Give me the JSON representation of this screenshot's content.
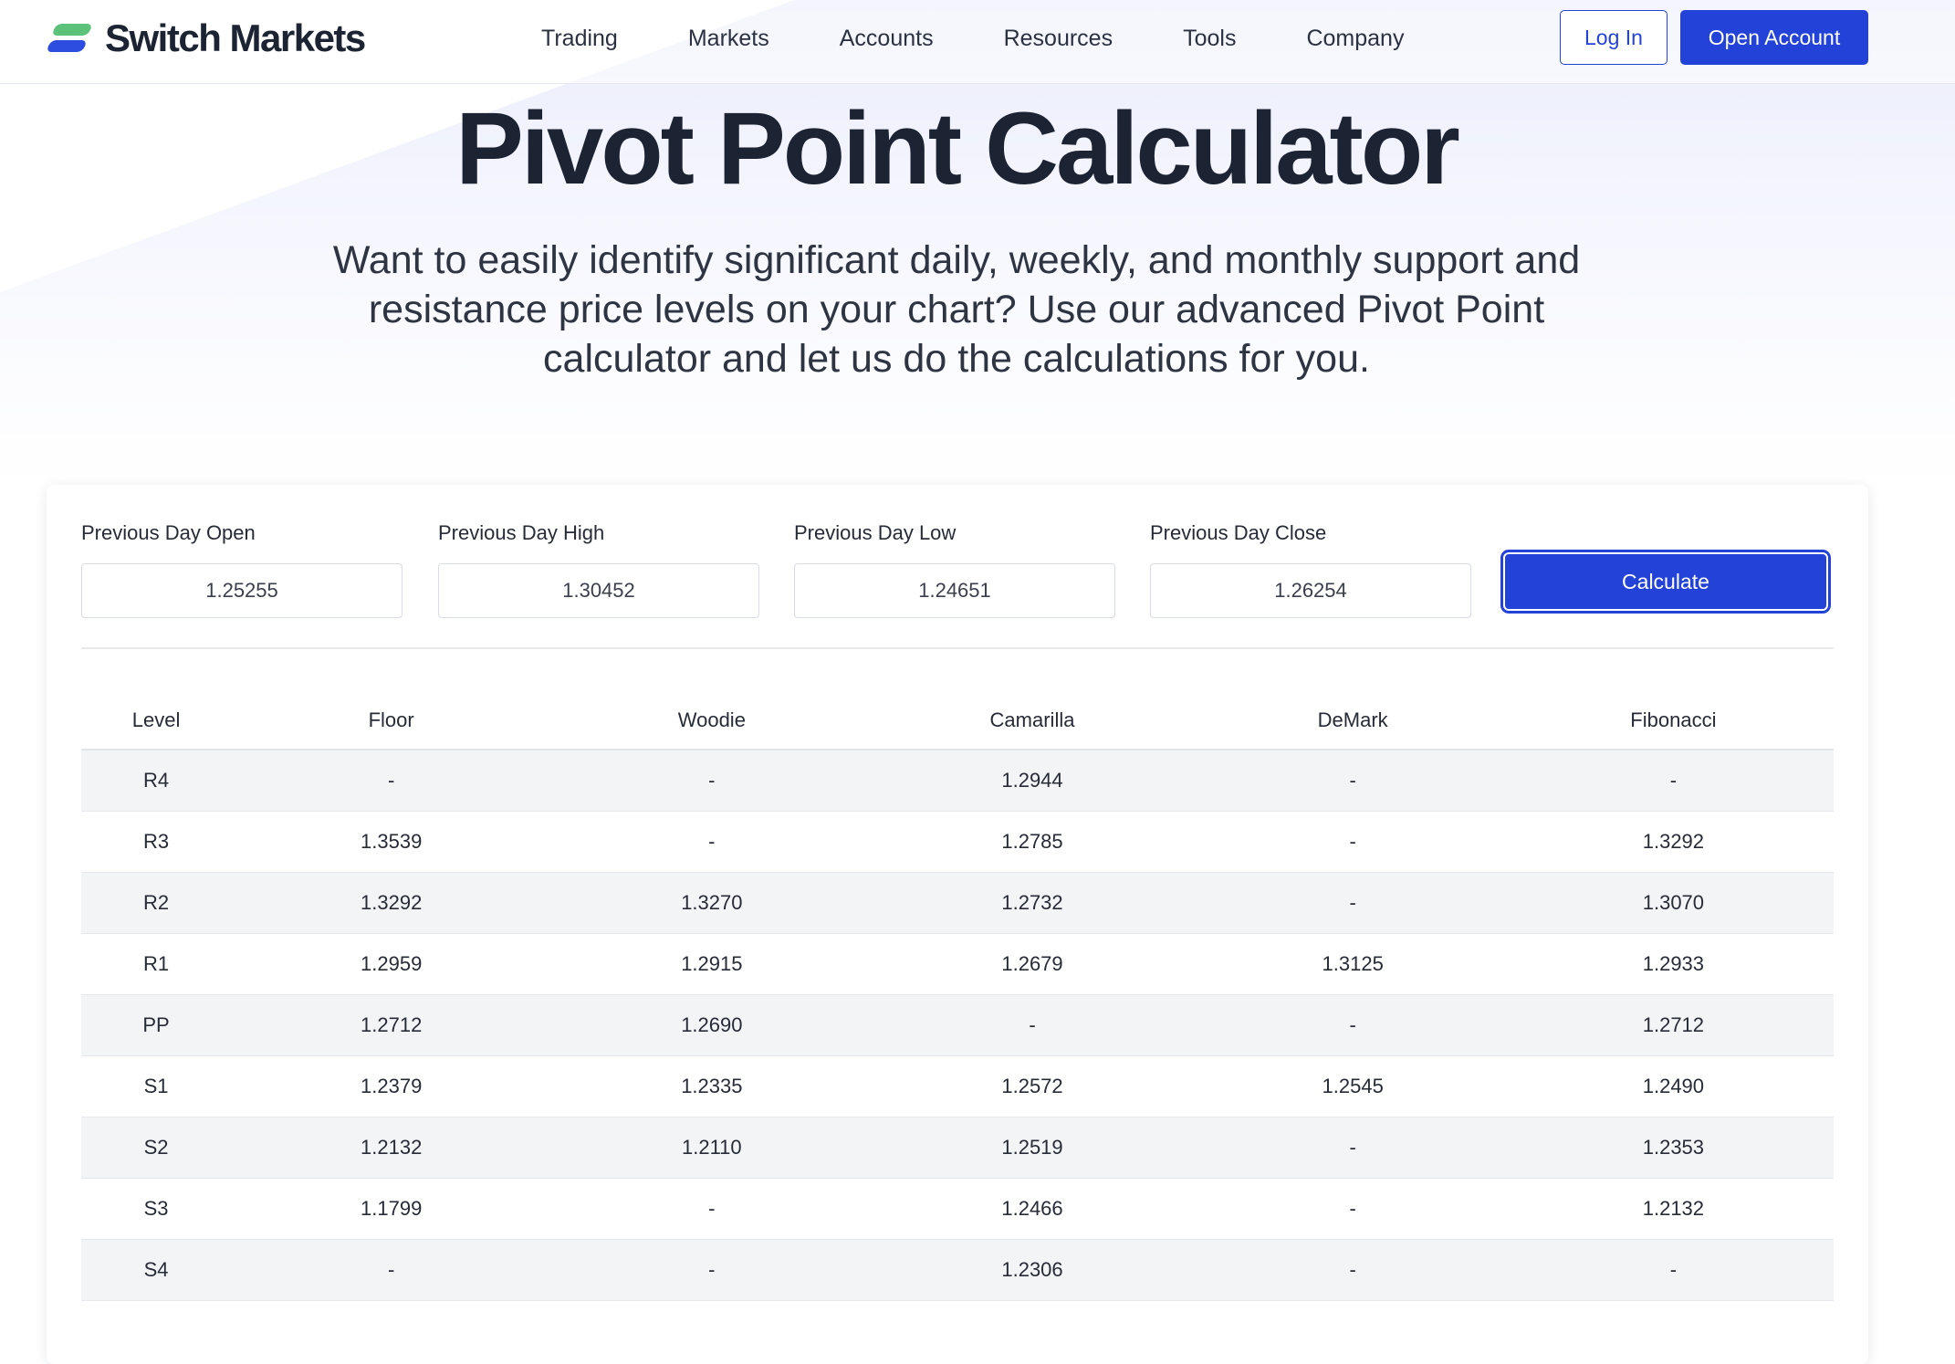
{
  "header": {
    "brand": "Switch Markets",
    "nav": [
      "Trading",
      "Markets",
      "Accounts",
      "Resources",
      "Tools",
      "Company"
    ],
    "login_label": "Log In",
    "open_account_label": "Open Account"
  },
  "hero": {
    "title": "Pivot Point Calculator",
    "subtitle": "Want to easily identify significant daily, weekly, and monthly support and resistance price levels on your chart? Use our advanced Pivot Point calculator and let us do the calculations for you."
  },
  "calculator": {
    "fields": [
      {
        "label": "Previous Day Open",
        "value": "1.25255"
      },
      {
        "label": "Previous Day High",
        "value": "1.30452"
      },
      {
        "label": "Previous Day Low",
        "value": "1.24651"
      },
      {
        "label": "Previous Day Close",
        "value": "1.26254"
      }
    ],
    "calculate_label": "Calculate"
  },
  "results": {
    "columns": [
      "Level",
      "Floor",
      "Woodie",
      "Camarilla",
      "DeMark",
      "Fibonacci"
    ],
    "rows": [
      [
        "R4",
        "-",
        "-",
        "1.2944",
        "-",
        "-"
      ],
      [
        "R3",
        "1.3539",
        "-",
        "1.2785",
        "-",
        "1.3292"
      ],
      [
        "R2",
        "1.3292",
        "1.3270",
        "1.2732",
        "-",
        "1.3070"
      ],
      [
        "R1",
        "1.2959",
        "1.2915",
        "1.2679",
        "1.3125",
        "1.2933"
      ],
      [
        "PP",
        "1.2712",
        "1.2690",
        "-",
        "-",
        "1.2712"
      ],
      [
        "S1",
        "1.2379",
        "1.2335",
        "1.2572",
        "1.2545",
        "1.2490"
      ],
      [
        "S2",
        "1.2132",
        "1.2110",
        "1.2519",
        "-",
        "1.2353"
      ],
      [
        "S3",
        "1.1799",
        "-",
        "1.2466",
        "-",
        "1.2132"
      ],
      [
        "S4",
        "-",
        "-",
        "1.2306",
        "-",
        "-"
      ]
    ]
  },
  "colors": {
    "accent": "#2342d8",
    "logo_green": "#5cc27a",
    "logo_blue": "#2c4de0",
    "text_dark": "#1c2333",
    "row_stripe": "#f3f4f6"
  },
  "icons": [
    "switch-markets-logo-icon"
  ]
}
